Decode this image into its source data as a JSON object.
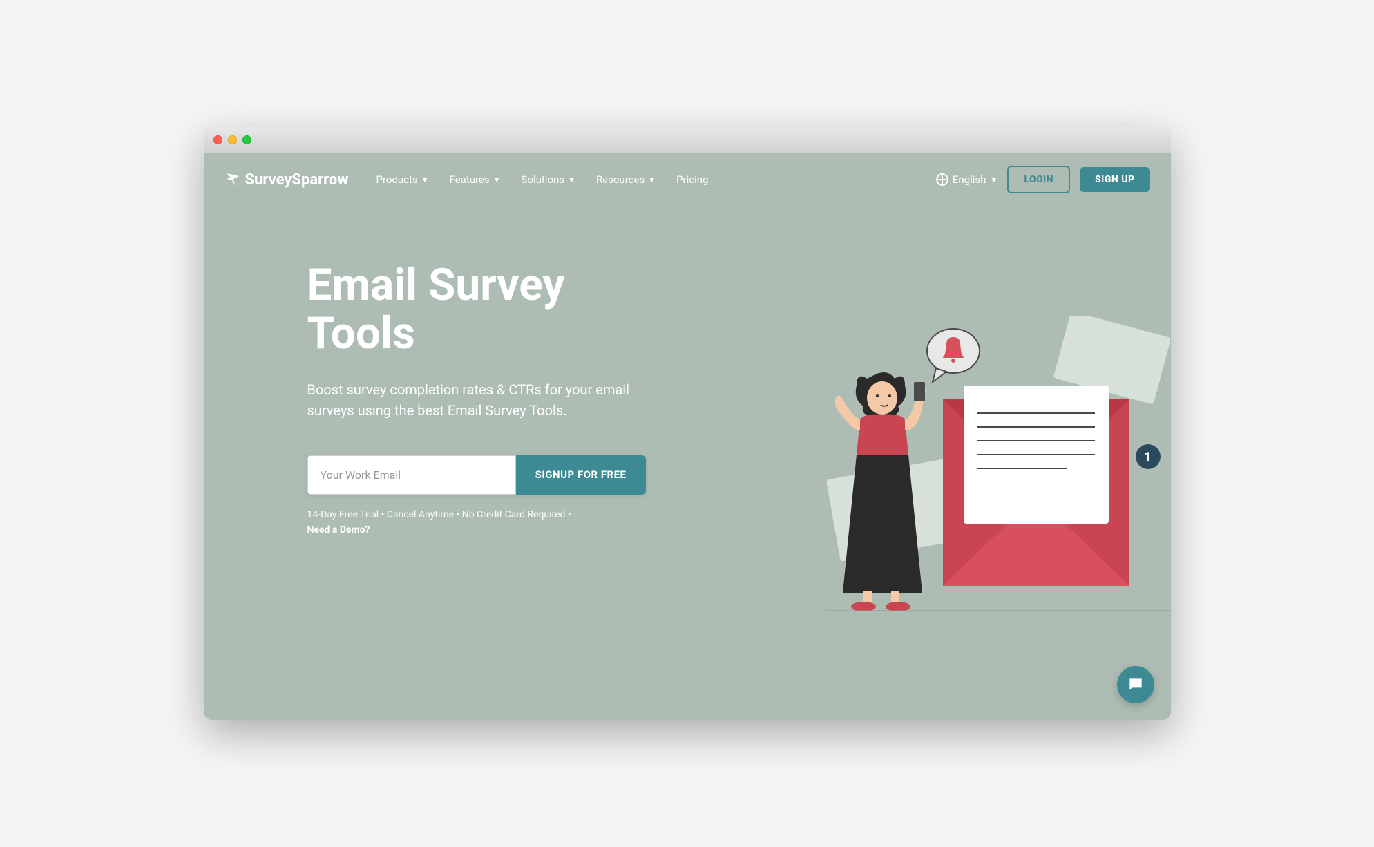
{
  "brand": "SurveySparrow",
  "nav": {
    "items": [
      "Products",
      "Features",
      "Solutions",
      "Resources",
      "Pricing"
    ],
    "language": "English",
    "login": "LOGIN",
    "signup": "SIGN UP"
  },
  "hero": {
    "title_line1": "Email Survey",
    "title_line2": "Tools",
    "subtitle": "Boost survey completion rates & CTRs for your email surveys using the best Email Survey Tools.",
    "email_placeholder": "Your Work Email",
    "cta": "SIGNUP FOR FREE",
    "disclaimer": "14-Day Free Trial • Cancel Anytime • No Credit Card Required • ",
    "demo": "Need a Demo?"
  },
  "badge": "1"
}
